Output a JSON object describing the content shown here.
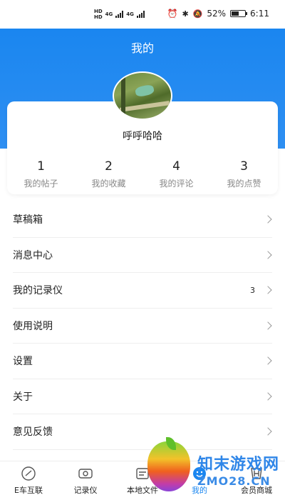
{
  "status_bar": {
    "hd1": "HD",
    "net1": "4G",
    "hd2": "HD",
    "net2": "4G",
    "battery": "52%",
    "time": "6:11"
  },
  "header": {
    "title": "我的"
  },
  "profile": {
    "username": "呼呼哈哈",
    "stats": [
      {
        "count": "1",
        "label": "我的帖子"
      },
      {
        "count": "2",
        "label": "我的收藏"
      },
      {
        "count": "4",
        "label": "我的评论"
      },
      {
        "count": "3",
        "label": "我的点赞"
      }
    ]
  },
  "menu": [
    {
      "label": "草稿箱"
    },
    {
      "label": "消息中心"
    },
    {
      "label": "我的记录仪",
      "badge": "3"
    },
    {
      "label": "使用说明"
    },
    {
      "label": "设置"
    },
    {
      "label": "关于"
    },
    {
      "label": "意见反馈"
    }
  ],
  "tabbar": [
    {
      "label": "E车互联",
      "icon": "speedometer-icon"
    },
    {
      "label": "记录仪",
      "icon": "camera-icon"
    },
    {
      "label": "本地文件",
      "icon": "folder-icon"
    },
    {
      "label": "我的",
      "icon": "profile-icon"
    },
    {
      "label": "会员商城",
      "icon": "honda-logo-icon"
    }
  ],
  "watermark": {
    "line1": "知末游戏网",
    "line2": "ZMO28.CN"
  },
  "colors": {
    "accent": "#1a86f0"
  }
}
